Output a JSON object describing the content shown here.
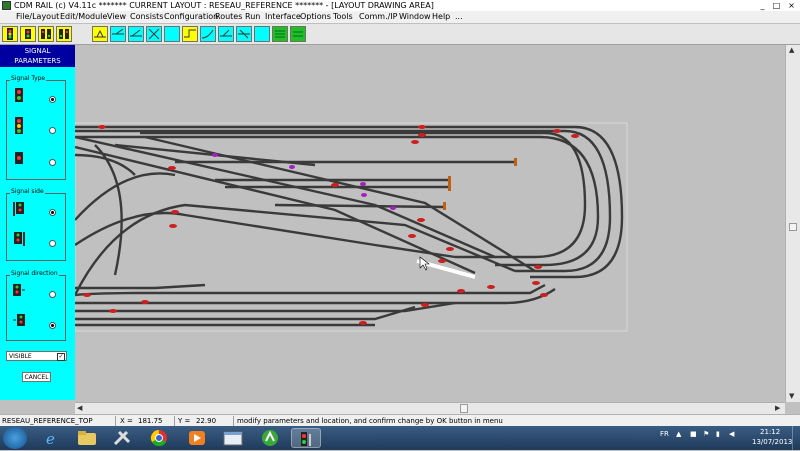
{
  "window": {
    "title": "CDM RAIL (c) V4.11c       ******* CURRENT LAYOUT : RESEAU_REFERENCE ******* - [LAYOUT DRAWING AREA]",
    "minimize": "_",
    "maximize": "□",
    "close": "×"
  },
  "menu": {
    "items": [
      "File/Layout",
      "Edit/Module",
      "View",
      "Consists",
      "Configuration",
      "Routes",
      "Run",
      "Interface",
      "Options",
      "Tools",
      "Comm./IP",
      "Window",
      "Help",
      "..."
    ]
  },
  "toolbar": {
    "icons": [
      "signal-3-aspect",
      "signal-2-aspect",
      "signal-aspect-change",
      "signal-double",
      "track-draw",
      "track-split",
      "track-switch",
      "track-delete",
      "blank",
      "track-straight",
      "track-curve",
      "track-junction",
      "track-cross",
      "blank",
      "block-green-1",
      "block-green-2"
    ]
  },
  "panel": {
    "header_line1": "SIGNAL",
    "header_line2": "PARAMETERS",
    "signal_type_label": "Signal Type",
    "signal_side_label": "Signal side",
    "signal_direction_label": "Signal direction",
    "visible_label": "VISIBLE",
    "visible_checked": "✓",
    "cancel_label": "CANCEL"
  },
  "status": {
    "layout_name": "RESEAU_REFERENCE_TOP",
    "x_label": "X =",
    "x_value": "181.75",
    "y_label": "Y =",
    "y_value": "22.90",
    "message": "modify parameters and location, and confirm change by OK button in menu"
  },
  "taskbar": {
    "lang": "FR",
    "time": "21:12",
    "date": "13/07/2013"
  },
  "colors": {
    "panel_bg": "#00ffff",
    "panel_header": "#0000a0",
    "canvas_bg": "#c0c0c0",
    "track": "#3a3a3a",
    "signal_marker": "#cc2020",
    "selected_marker": "#a020c0",
    "buffer_stop": "#c06010"
  }
}
